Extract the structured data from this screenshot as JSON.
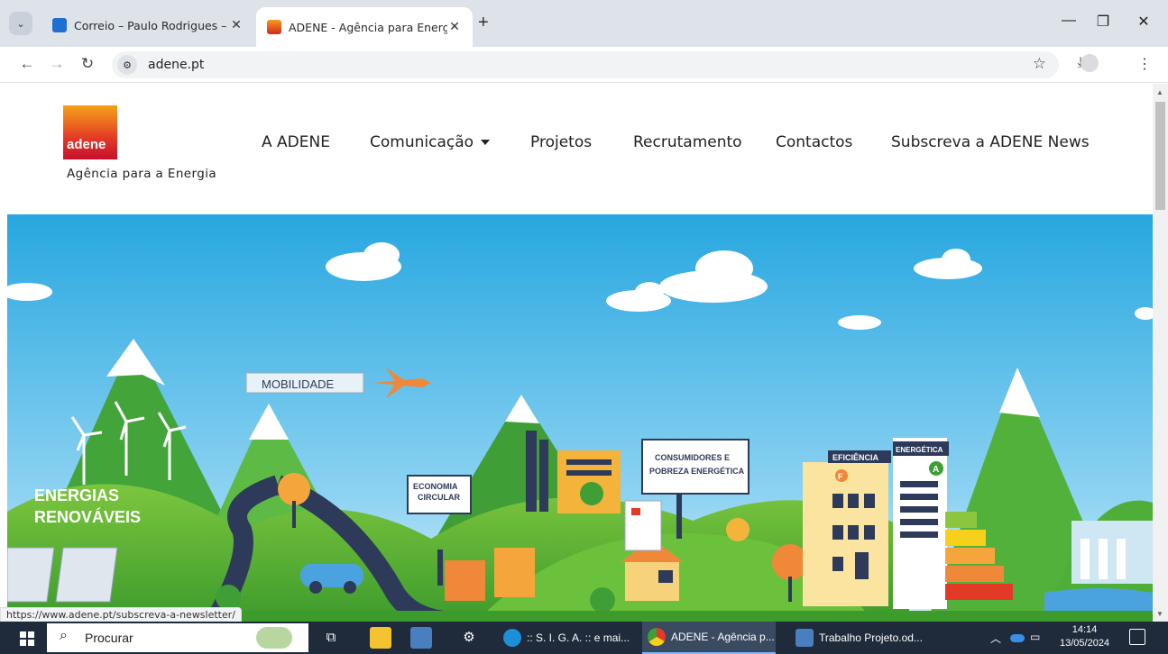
{
  "browser": {
    "tabs": [
      {
        "title": "Correio – Paulo Rodrigues – Ou",
        "favicon": "outlook-icon",
        "color": "#1f6fd1"
      },
      {
        "title": "ADENE - Agência para Energia",
        "favicon": "adene-icon",
        "color": "#d9261c",
        "active": true
      }
    ],
    "url": "adene.pt",
    "status_url": "https://www.adene.pt/subscreva-a-newsletter/"
  },
  "site": {
    "logo_text": "adene",
    "tagline": "Agência para a Energia",
    "nav": [
      "A ADENE",
      "Comunicação",
      "Projetos",
      "Recrutamento",
      "Contactos",
      "Subscreva a ADENE News"
    ]
  },
  "hero": {
    "labels": {
      "mobilidade": "MOBILIDADE",
      "energias": "ENERGIAS",
      "renovaveis": "RENOVÁVEIS",
      "economia": "ECONOMIA",
      "circular": "CIRCULAR",
      "consumidores1": "CONSUMIDORES E",
      "consumidores2": "POBREZA ENERGÉTICA",
      "eficiencia": "EFICIÊNCIA",
      "energetica": "ENERGÉTICA",
      "class_f": "F",
      "class_a": "A"
    }
  },
  "taskbar": {
    "search_label": "Procurar",
    "apps": [
      {
        "label": ":: S. I. G. A. :: e mai...",
        "icon": "edge-icon"
      },
      {
        "label": "ADENE - Agência p...",
        "icon": "chrome-icon",
        "active": true
      },
      {
        "label": "Trabalho Projeto.od...",
        "icon": "document-icon"
      }
    ],
    "time": "14:14",
    "date": "13/05/2024"
  },
  "colors": {
    "sky_top": "#29a9e1",
    "sky_bottom": "#bfe6f7",
    "hill_green": "#5cb833",
    "brand_red": "#c8102e",
    "taskbar": "#1f2a3a"
  }
}
